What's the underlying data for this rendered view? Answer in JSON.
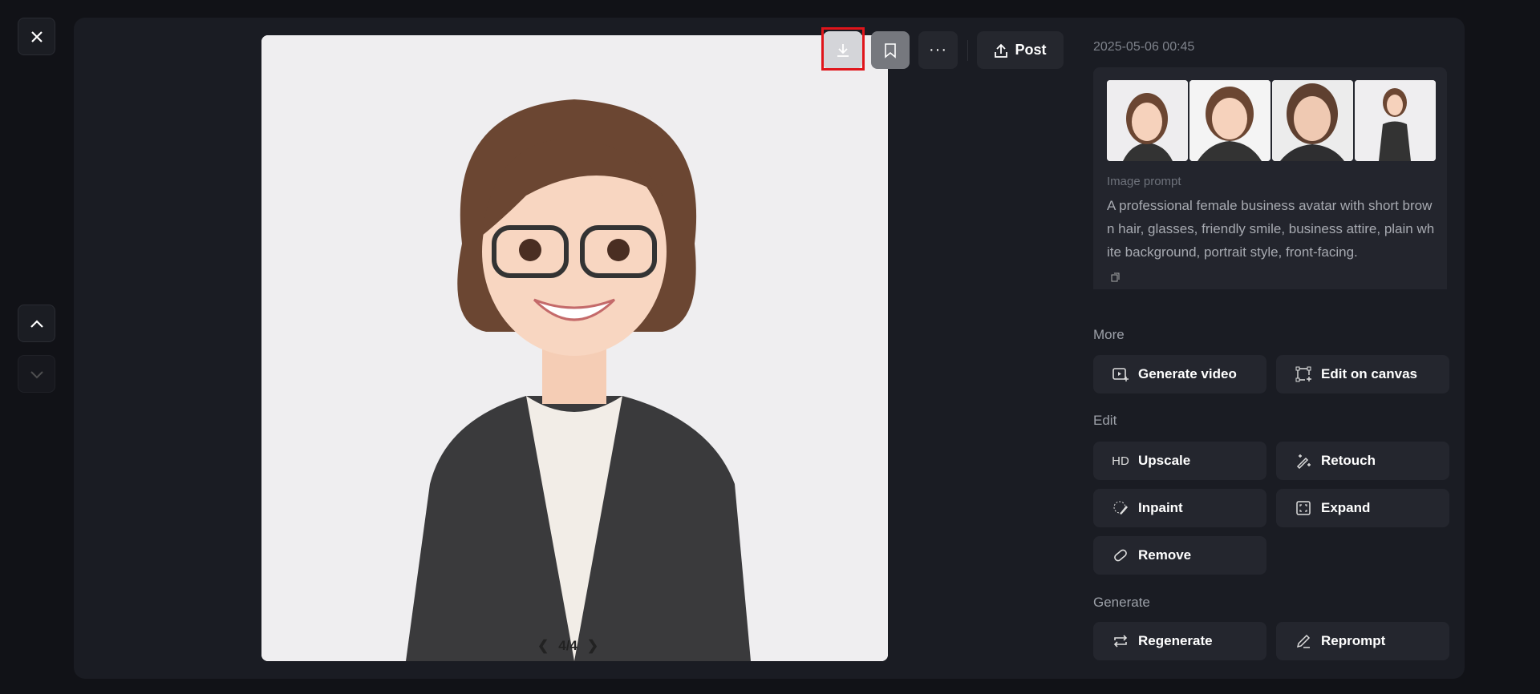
{
  "close_icon": "close-icon",
  "toolbar": {
    "post_label": "Post"
  },
  "image": {
    "pagination": "4/4"
  },
  "details": {
    "date": "2025-05-06 00:45",
    "prompt_label": "Image prompt",
    "prompt_text": "A professional female business avatar with short brown hair, glasses, friendly smile, business attire, plain white background, portrait style, front-facing."
  },
  "sections": {
    "more": {
      "label": "More",
      "buttons": [
        "Generate video",
        "Edit on canvas"
      ]
    },
    "edit": {
      "label": "Edit",
      "hd_badge": "HD",
      "buttons": [
        "Upscale",
        "Retouch",
        "Inpaint",
        "Expand",
        "Remove"
      ]
    },
    "generate": {
      "label": "Generate",
      "buttons": [
        "Regenerate",
        "Reprompt"
      ]
    }
  },
  "colors": {
    "highlight": "#e0151b",
    "panel": "#1a1c23",
    "button": "#24262e"
  }
}
